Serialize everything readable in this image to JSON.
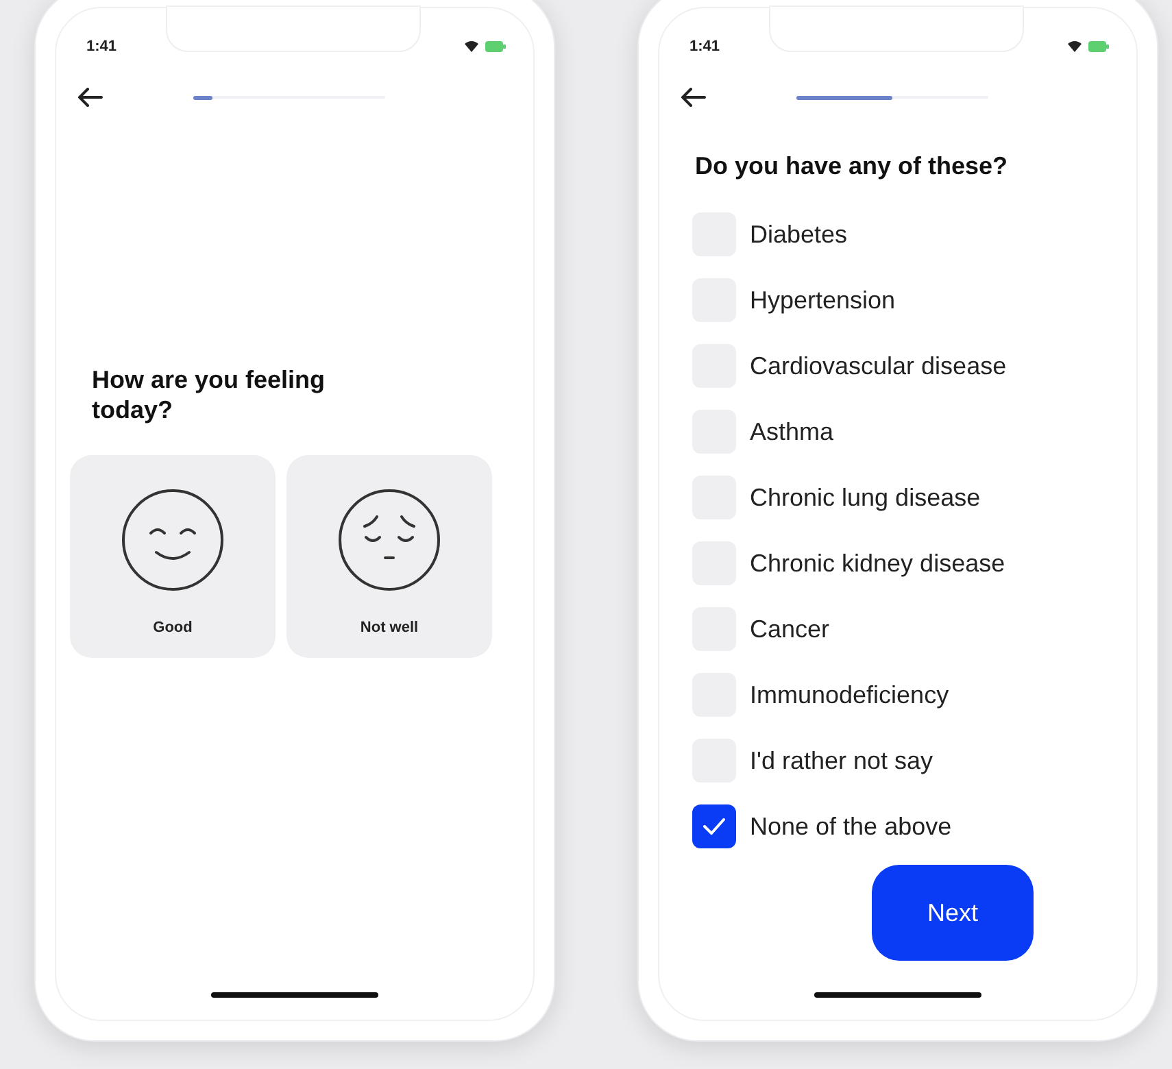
{
  "screens": [
    {
      "kind": "mood",
      "status_time": "1:41",
      "progress": {
        "level": 0.1
      },
      "title": "How are you feeling today?",
      "options": [
        {
          "kind": "happy",
          "label": "Good"
        },
        {
          "kind": "sad",
          "label": "Not well"
        }
      ]
    },
    {
      "kind": "checklist",
      "status_time": "1:41",
      "progress": {
        "level": 0.5
      },
      "title": "Do you have any of these?",
      "items": [
        {
          "label": "Diabetes",
          "checked": false
        },
        {
          "label": "Hypertension",
          "checked": false
        },
        {
          "label": "Cardiovascular disease",
          "checked": false
        },
        {
          "label": "Asthma",
          "checked": false
        },
        {
          "label": "Chronic lung disease",
          "checked": false
        },
        {
          "label": "Chronic kidney disease",
          "checked": false
        },
        {
          "label": "Cancer",
          "checked": false
        },
        {
          "label": "Immunodeficiency",
          "checked": false
        },
        {
          "label": "I'd rather not say",
          "checked": false
        },
        {
          "label": "None of the above",
          "checked": true
        }
      ],
      "button": "Next"
    }
  ]
}
